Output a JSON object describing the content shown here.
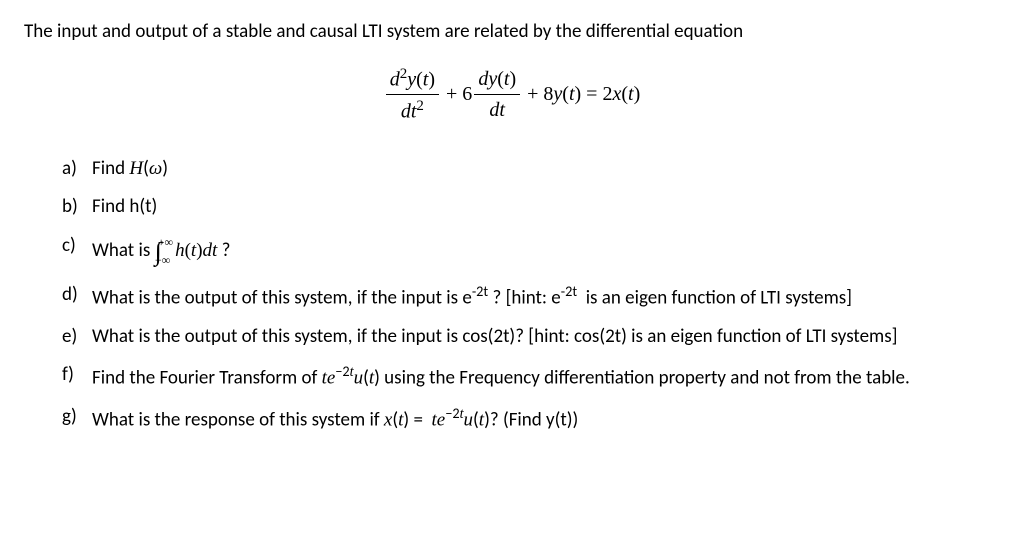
{
  "intro": "The input and output of a stable and causal LTI system are related by the differential equation",
  "equation_html": "<span class='frac'><span class='num'><i>d</i><sup>2</sup><i>y</i>(<i>t</i>)</span><span class='den'><i>dt</i><sup>2</sup></span></span> + 6<span class='frac'><span class='num'><i>dy</i>(<i>t</i>)</span><span class='den'><i>dt</i></span></span> + 8<i>y</i>(<i>t</i>) = 2<i>x</i>(<i>t</i>)",
  "items": [
    {
      "label": "a)",
      "html": "Find <span class='math'>H</span>(<span class='math'>ω</span>)"
    },
    {
      "label": "b)",
      "html": "Find h(t)"
    },
    {
      "label": "c)",
      "html": "What is <span class='integral'><span class='big-int'>∫</span><span class='int-lim int-lim-top'>+∞</span><span class='int-lim int-lim-bot'>−∞</span> <i>h</i>(<i>t</i>)<i>dt</i></span> ?"
    },
    {
      "label": "d)",
      "html": "What is the output of this system, if the input is e<sup>-2t</sup> ? [hint: e<sup>-2t</sup>&nbsp; is an eigen function of LTI systems]"
    },
    {
      "label": "e)",
      "html": "What is the output of this system, if the input is cos(2t)? [hint: cos(2t) is an eigen function of LTI systems]"
    },
    {
      "label": "f)",
      "html": "Find the Fourier Transform of <span class='math'>te</span><sup>−2<span class='math'>t</span></sup><span class='math'>u</span>(<span class='math'>t</span>) using the Frequency differentiation property and not from the table."
    },
    {
      "label": "g)",
      "html": "What is the response of this system if <span class='math'>x</span>(<span class='math'>t</span>) = &nbsp;<span class='math'>te</span><sup>−2<span class='math'>t</span></sup><span class='math'>u</span>(<span class='math'>t</span>)? (Find y(t))"
    }
  ]
}
